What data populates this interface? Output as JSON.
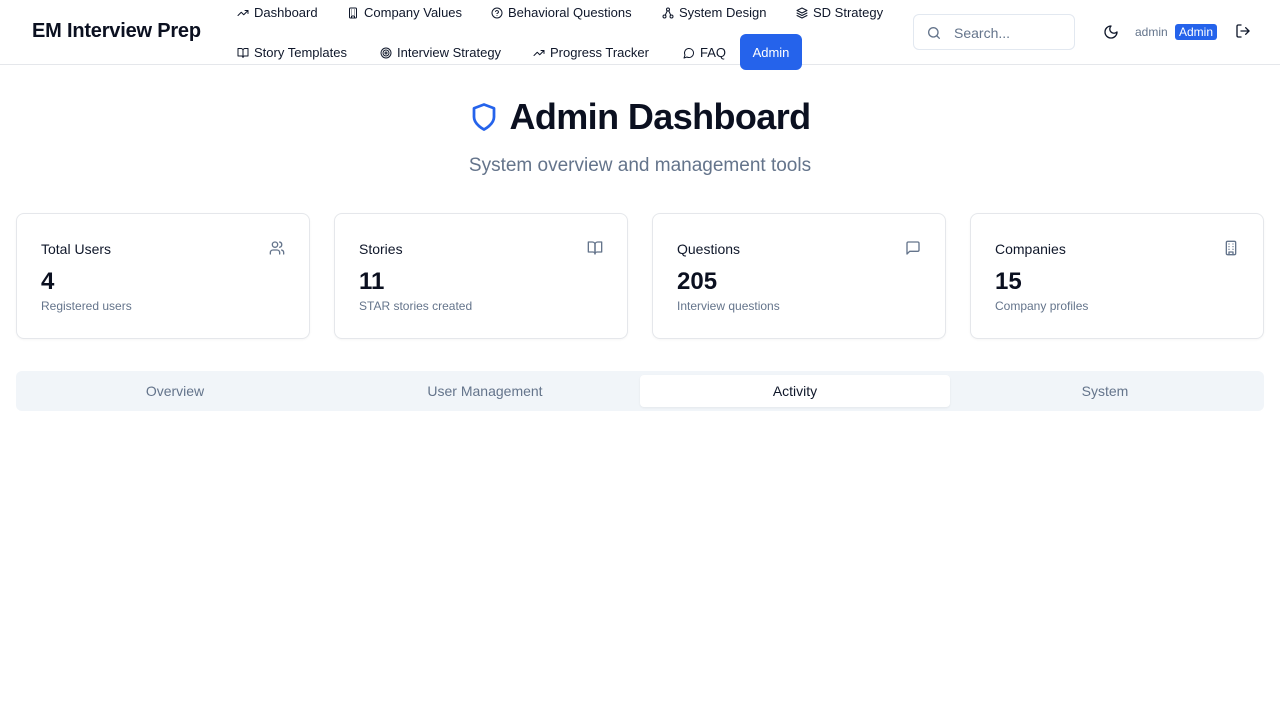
{
  "app": {
    "title": "EM Interview Prep"
  },
  "nav": {
    "items": [
      {
        "label": "Dashboard",
        "icon": "trending-up-icon"
      },
      {
        "label": "Company Values",
        "icon": "building-icon"
      },
      {
        "label": "Behavioral Questions",
        "icon": "help-circle-icon"
      },
      {
        "label": "System Design",
        "icon": "network-icon"
      },
      {
        "label": "SD Strategy",
        "icon": "layers-icon"
      },
      {
        "label": "Story Templates",
        "icon": "book-open-icon"
      },
      {
        "label": "Interview Strategy",
        "icon": "target-icon"
      },
      {
        "label": "Progress Tracker",
        "icon": "trending-up-icon"
      },
      {
        "label": "FAQ",
        "icon": "message-circle-icon"
      },
      {
        "label": "Admin",
        "icon": ""
      }
    ],
    "active": "Admin"
  },
  "search": {
    "placeholder": "Search..."
  },
  "user": {
    "name": "admin",
    "role": "Admin"
  },
  "page": {
    "title": "Admin Dashboard",
    "subtitle": "System overview and management tools"
  },
  "stats": [
    {
      "label": "Total Users",
      "value": "4",
      "desc": "Registered users",
      "icon": "users-icon"
    },
    {
      "label": "Stories",
      "value": "11",
      "desc": "STAR stories created",
      "icon": "book-open-icon"
    },
    {
      "label": "Questions",
      "value": "205",
      "desc": "Interview questions",
      "icon": "message-square-icon"
    },
    {
      "label": "Companies",
      "value": "15",
      "desc": "Company profiles",
      "icon": "building-icon"
    }
  ],
  "tabs": [
    {
      "label": "Overview"
    },
    {
      "label": "User Management"
    },
    {
      "label": "Activity"
    },
    {
      "label": "System"
    }
  ],
  "active_tab": "Activity",
  "colors": {
    "accent": "#2563eb",
    "muted": "#64748b",
    "border": "#e5e7eb",
    "tab_bg": "#f1f5f9"
  }
}
